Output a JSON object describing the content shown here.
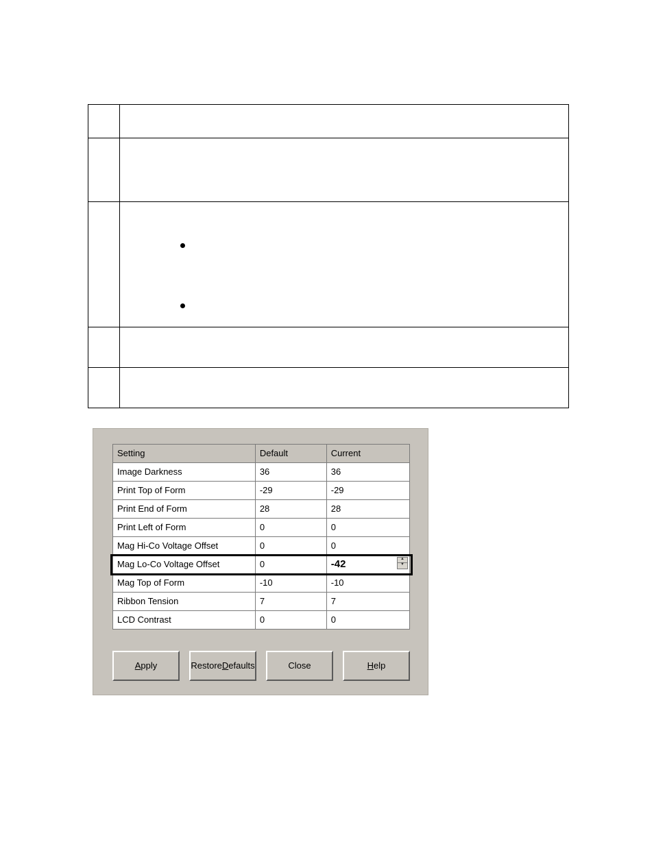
{
  "instruction_table": {
    "rows": [
      {
        "step": "",
        "body": ""
      },
      {
        "step": "",
        "body": ""
      },
      {
        "step": "",
        "body": "",
        "bullets": [
          "",
          ""
        ]
      },
      {
        "step": "",
        "body": ""
      },
      {
        "step": "",
        "body": ""
      }
    ]
  },
  "settings_panel": {
    "columns": {
      "setting": "Setting",
      "default": "Default",
      "current": "Current"
    },
    "rows": [
      {
        "setting": "Image Darkness",
        "default": "36",
        "current": "36"
      },
      {
        "setting": "Print Top of Form",
        "default": "-29",
        "current": "-29"
      },
      {
        "setting": "Print End of Form",
        "default": "28",
        "current": "28"
      },
      {
        "setting": "Print Left of Form",
        "default": "0",
        "current": "0"
      },
      {
        "setting": "Mag Hi-Co Voltage Offset",
        "default": "0",
        "current": "0"
      },
      {
        "setting": "Mag Lo-Co Voltage Offset",
        "default": "0",
        "current": "-42",
        "highlight": true,
        "editable": true
      },
      {
        "setting": "Mag Top of Form",
        "default": "-10",
        "current": "-10"
      },
      {
        "setting": "Ribbon Tension",
        "default": "7",
        "current": "7"
      },
      {
        "setting": "LCD Contrast",
        "default": "0",
        "current": "0"
      }
    ],
    "buttons": {
      "apply": {
        "text": "Apply",
        "accel": "A"
      },
      "restore": {
        "text": "Restore Defaults",
        "accel": "D"
      },
      "close": {
        "text": "Close",
        "accel": ""
      },
      "help": {
        "text": "Help",
        "accel": "H"
      }
    }
  }
}
